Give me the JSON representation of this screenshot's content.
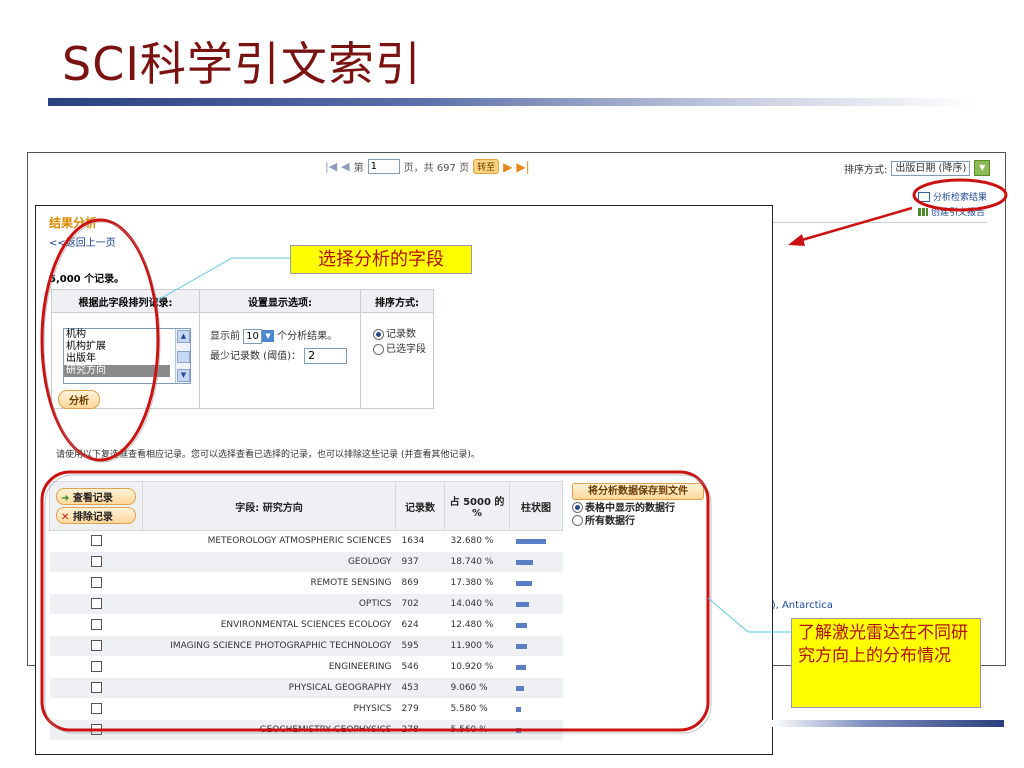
{
  "slide": {
    "title": "SCI科学引文索引"
  },
  "pager": {
    "first_icon": "first-page-icon",
    "prev_icon": "prev-page-icon",
    "page_label_pre": "第",
    "page_value": "1",
    "page_label_post": "页，共 697 页",
    "goto_label": "转至",
    "next_icon": "next-page-icon",
    "last_icon": "last-page-icon"
  },
  "sort_top": {
    "label": "排序方式:",
    "value": "出版日期 (降序)"
  },
  "right_links": {
    "analyze_results": "分析检索结果",
    "create_report": "创建引文报告"
  },
  "background_text": {
    "antarctica": "s E), Antarctica"
  },
  "panel": {
    "title": "结果分析",
    "back_link": "<<返回上一页",
    "record_count": "5,000 个记录。",
    "options": {
      "col_rank_header": "根据此字段排列记录:",
      "col_display_header": "设置显示选项:",
      "col_sort_header": "排序方式:",
      "fields": [
        "机构",
        "机构扩展",
        "出版年",
        "研究方向"
      ],
      "selected_field": "研究方向",
      "show_top_pre": "显示前",
      "show_top_value": "10",
      "show_top_post": "个分析结果。",
      "min_records_label": "最少记录数 (阈值)：",
      "min_records_value": "2",
      "sort_by_count": "记录数",
      "sort_by_field": "已选字段"
    },
    "analyze_button": "分析",
    "instructions": "请使用以下复选框查看相应记录。您可以选择查看已选择的记录，也可以排除这些记录 (并查看其他记录)。",
    "results": {
      "view_button": "查看记录",
      "exclude_button": "排除记录",
      "field_header": "字段: 研究方向",
      "count_header": "记录数",
      "pct_header": "占 5000 的 %",
      "bar_header": "柱状图",
      "save_button": "将分析数据保存到文件",
      "save_opt_table": "表格中显示的数据行",
      "save_opt_all": "所有数据行",
      "rows": [
        {
          "field": "METEOROLOGY ATMOSPHERIC SCIENCES",
          "count": "1634",
          "pct": "32.680 %",
          "share": 32.68
        },
        {
          "field": "GEOLOGY",
          "count": "937",
          "pct": "18.740 %",
          "share": 18.74
        },
        {
          "field": "REMOTE SENSING",
          "count": "869",
          "pct": "17.380 %",
          "share": 17.38
        },
        {
          "field": "OPTICS",
          "count": "702",
          "pct": "14.040 %",
          "share": 14.04
        },
        {
          "field": "ENVIRONMENTAL SCIENCES ECOLOGY",
          "count": "624",
          "pct": "12.480 %",
          "share": 12.48
        },
        {
          "field": "IMAGING SCIENCE PHOTOGRAPHIC TECHNOLOGY",
          "count": "595",
          "pct": "11.900 %",
          "share": 11.9
        },
        {
          "field": "ENGINEERING",
          "count": "546",
          "pct": "10.920 %",
          "share": 10.92
        },
        {
          "field": "PHYSICAL GEOGRAPHY",
          "count": "453",
          "pct": "9.060 %",
          "share": 9.06
        },
        {
          "field": "PHYSICS",
          "count": "279",
          "pct": "5.580 %",
          "share": 5.58
        },
        {
          "field": "GEOCHEMISTRY GEOPHYSICS",
          "count": "278",
          "pct": "5.560 %",
          "share": 5.56
        }
      ]
    }
  },
  "callouts": {
    "select_field": "选择分析的字段",
    "distribution": "了解激光雷达在不同研究方向上的分布情况"
  },
  "colors": {
    "title": "#7a1212",
    "annotation": "#cc1111",
    "callout_bg": "#ffff00",
    "bar": "#5a7ec4"
  }
}
